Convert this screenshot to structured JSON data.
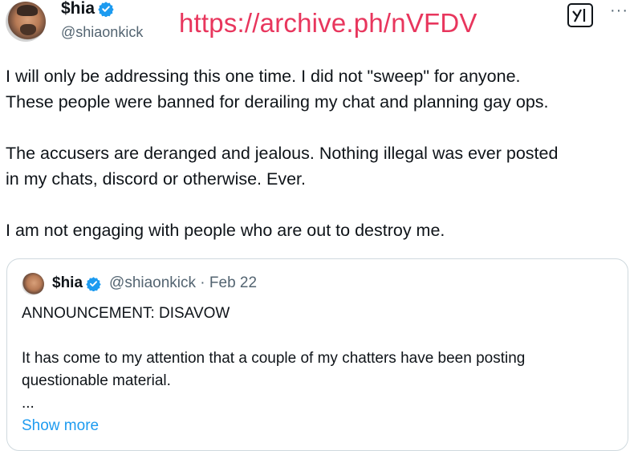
{
  "header": {
    "display_name": "$hia",
    "handle": "@shiaonkick",
    "archive_url": "https://archive.ph/nVFDV",
    "grok_icon": "grok-icon",
    "more_label": "···"
  },
  "post": {
    "paragraphs": [
      "I will only be addressing this one time.  I did not \"sweep\" for anyone.",
      "These people were banned for derailing my chat and planning gay ops.",
      "The accusers are deranged and jealous.  Nothing illegal was ever posted",
      "in my chats, discord or otherwise.  Ever.",
      "I am not engaging with people who are out to destroy me."
    ]
  },
  "quote": {
    "display_name": "$hia",
    "meta": "@shiaonkick · Feb 22",
    "title": "ANNOUNCEMENT: DISAVOW",
    "line1": "It has come to my attention that a couple of my chatters have been posting",
    "line2": "questionable material.",
    "ellipsis": "...",
    "show_more": "Show more"
  },
  "colors": {
    "verified": "#1d9bf0",
    "archive_link": "#e8365d",
    "muted": "#536471",
    "link": "#1d9bf0"
  }
}
